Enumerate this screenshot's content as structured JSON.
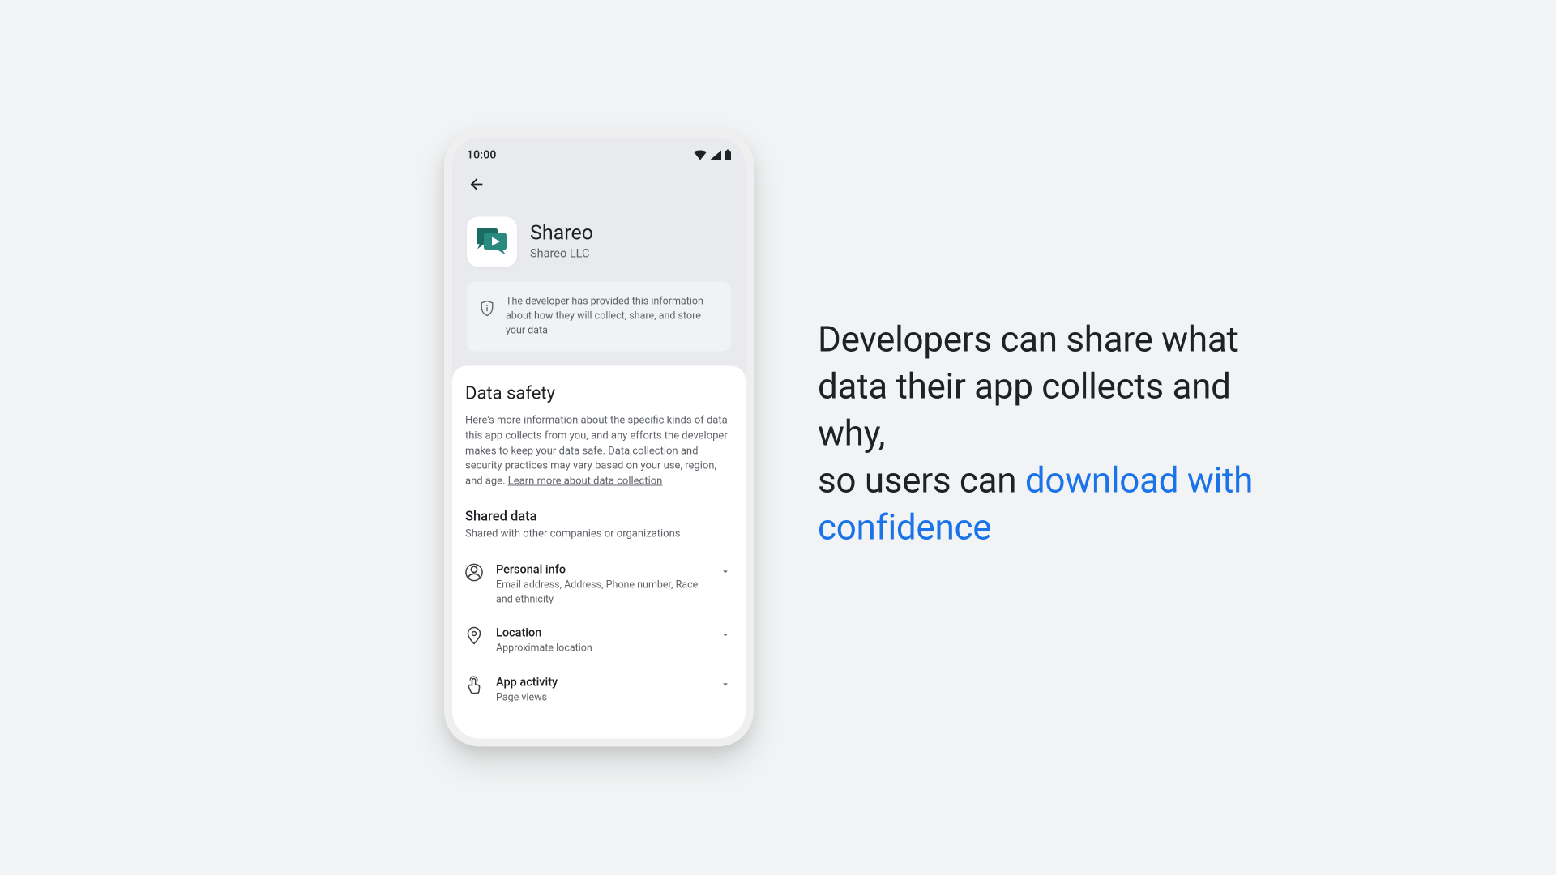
{
  "status": {
    "time": "10:00"
  },
  "app": {
    "name": "Shareo",
    "developer": "Shareo LLC",
    "info_banner": "The developer has provided this information about how they will collect, share, and store your data"
  },
  "safety": {
    "title": "Data safety",
    "description": "Here's more information about the specific kinds of data this app collects from you, and any efforts the developer makes to keep your data safe. Data collection and security practices may vary based on your use, region, and age. ",
    "learn_more": "Learn more about data collection"
  },
  "shared": {
    "title": "Shared data",
    "subtitle": "Shared with other companies or organizations",
    "items": [
      {
        "icon": "person",
        "title": "Personal info",
        "sub": "Email address, Address, Phone number, Race and ethnicity"
      },
      {
        "icon": "location",
        "title": "Location",
        "sub": "Approximate location"
      },
      {
        "icon": "touch",
        "title": "App activity",
        "sub": "Page views"
      }
    ]
  },
  "headline": {
    "part1": "Developers can share what data their app collects and why,",
    "part2": "so users can ",
    "emphasis": "download with confidence"
  }
}
